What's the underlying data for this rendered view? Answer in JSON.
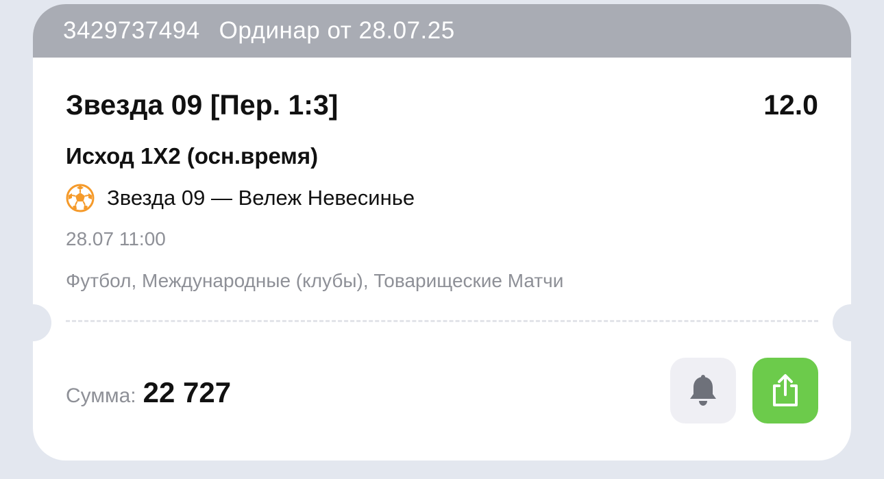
{
  "header": {
    "bet_id": "3429737494",
    "bet_type": "Ординар от 28.07.25"
  },
  "selection": {
    "pick": "Звезда 09 [Пер. 1:3]",
    "odds": "12.0",
    "market": "Исход 1X2 (осн.время)"
  },
  "event": {
    "sport_icon": "soccer-ball-icon",
    "teams": "Звезда 09 — Вележ Невесинье",
    "datetime": "28.07 11:00",
    "league": "Футбол, Международные (клубы), Товарищеские Матчи"
  },
  "footer": {
    "sum_label": "Сумма:",
    "sum_value": "22 727",
    "bell_icon": "bell-icon",
    "share_icon": "share-icon"
  },
  "colors": {
    "header_bg": "#a9acb4",
    "share_button": "#6ccb4b",
    "bell_button": "#efeff4",
    "page_bg": "#e3e7ef",
    "ball_accent": "#f59a2a"
  }
}
